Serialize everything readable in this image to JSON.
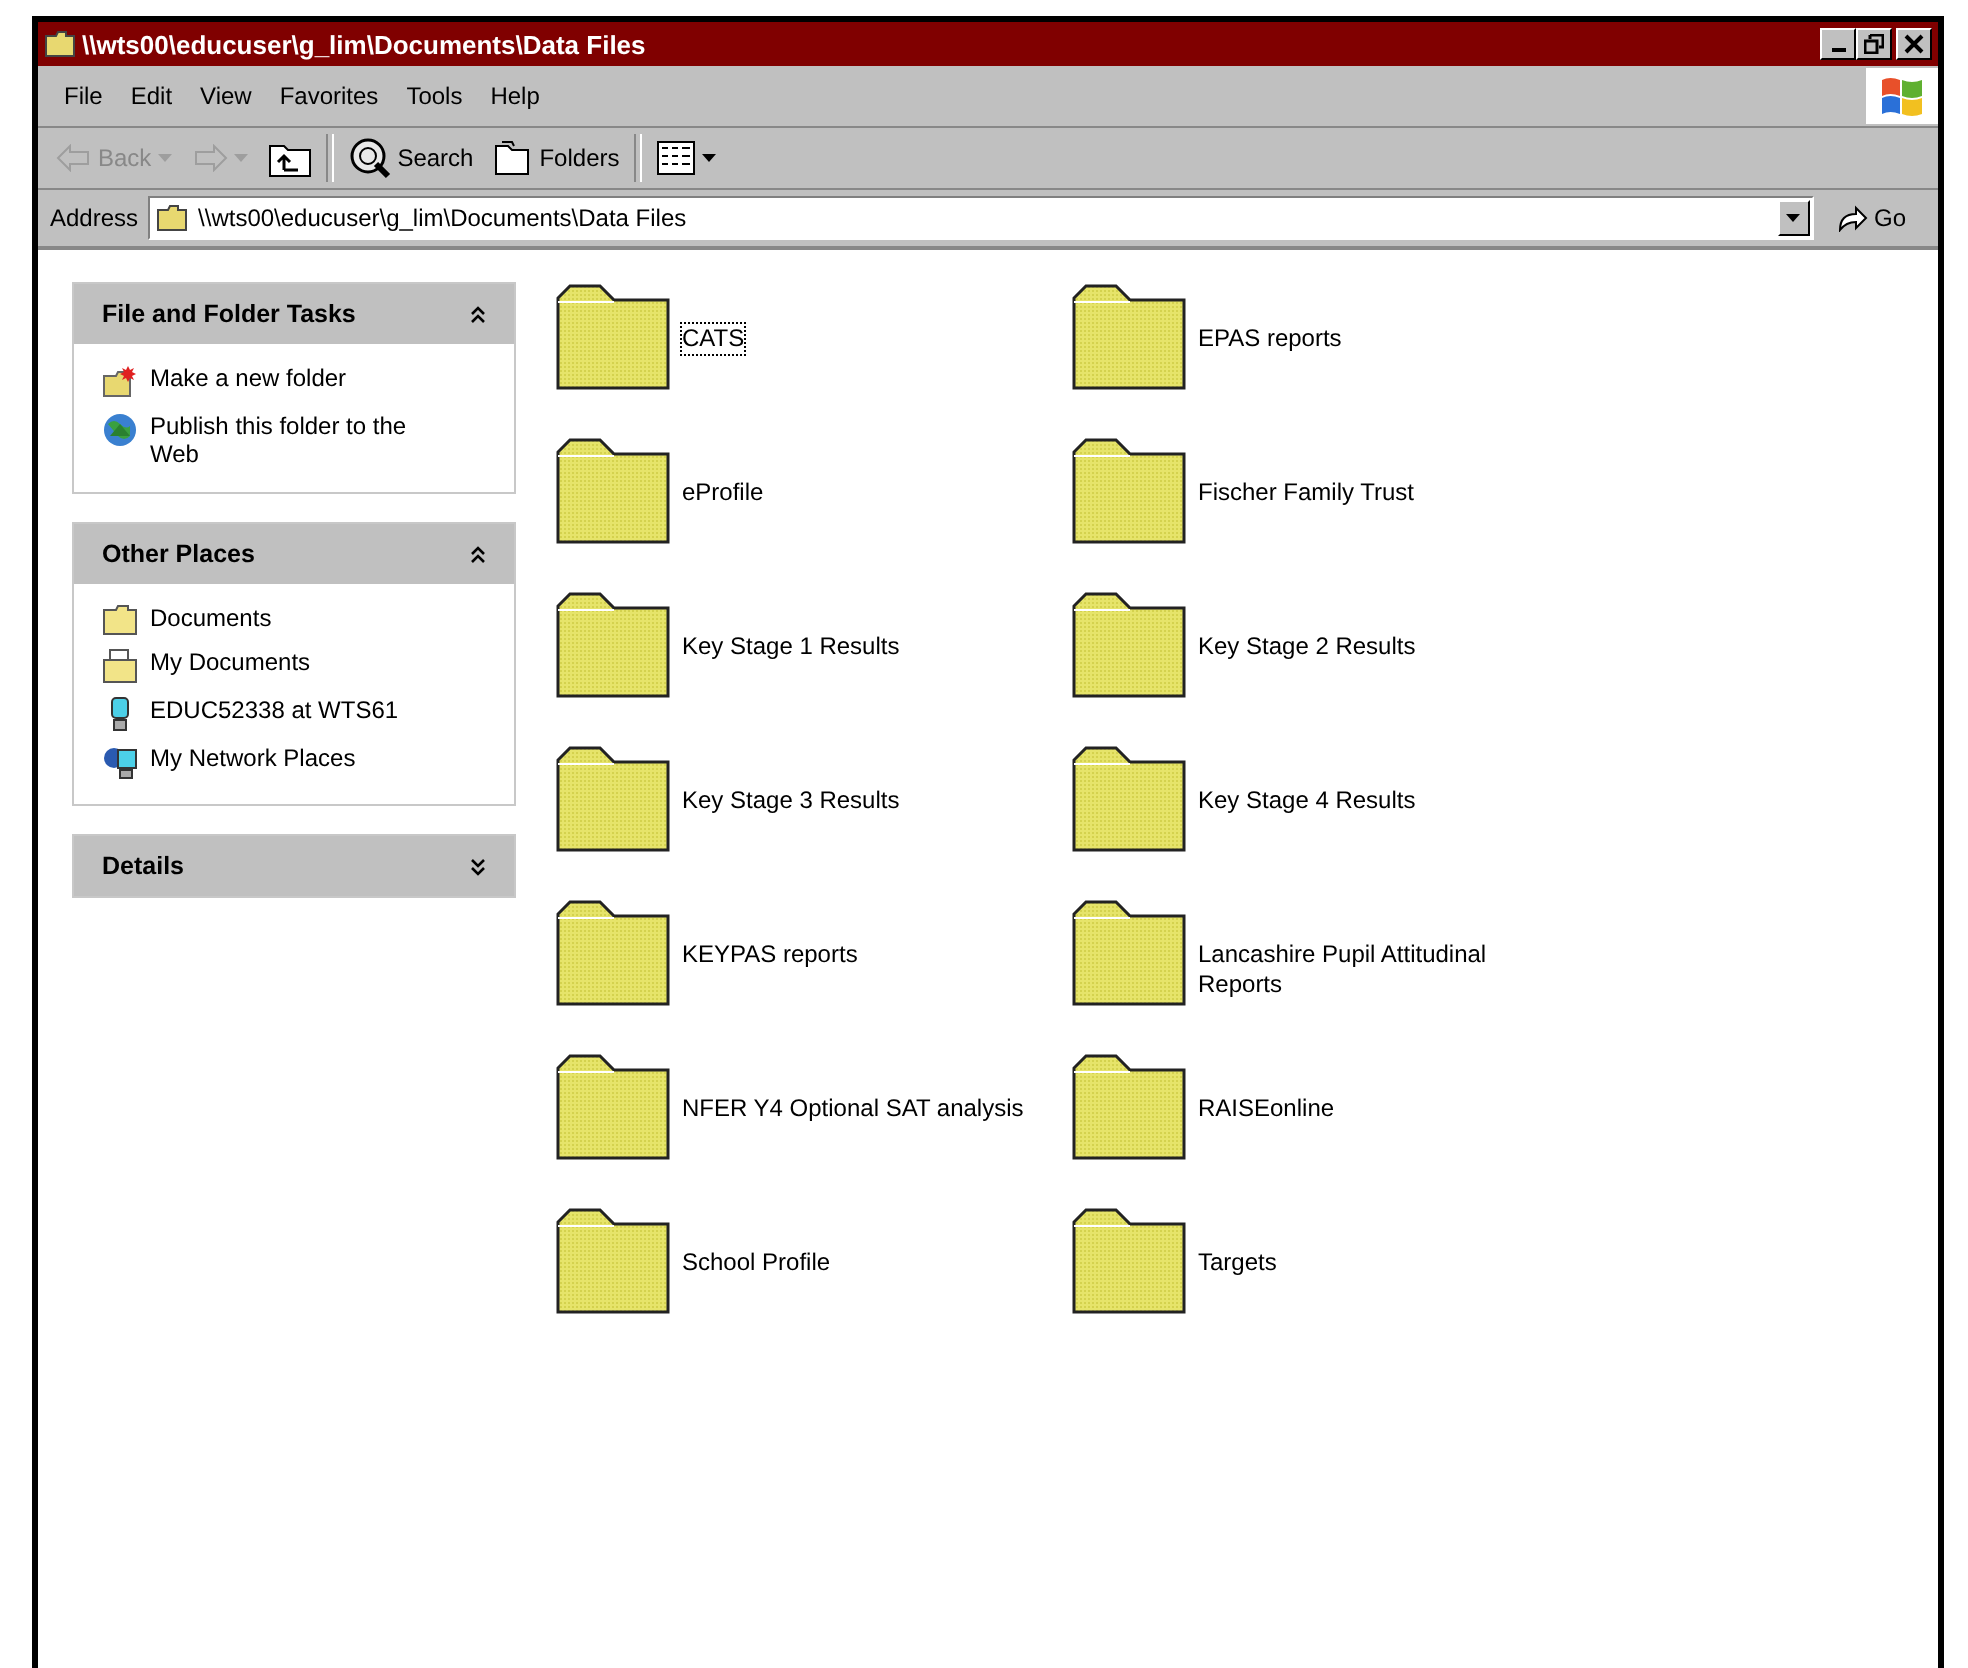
{
  "window": {
    "title": "\\\\wts00\\educuser\\g_lim\\Documents\\Data Files"
  },
  "menu": [
    "File",
    "Edit",
    "View",
    "Favorites",
    "Tools",
    "Help"
  ],
  "toolbar": [
    {
      "kind": "back",
      "label": "Back",
      "disabled": true
    },
    {
      "kind": "forward",
      "disabled": true
    },
    {
      "kind": "up",
      "disabled": false
    },
    {
      "kind": "search",
      "label": "Search",
      "disabled": false
    },
    {
      "kind": "folders",
      "label": "Folders",
      "disabled": false
    },
    {
      "kind": "views",
      "disabled": false
    }
  ],
  "address": {
    "label": "Address",
    "value": "\\\\wts00\\educuser\\g_lim\\Documents\\Data Files",
    "go": "Go"
  },
  "panels": [
    {
      "title": "File and Folder Tasks",
      "expanded": true,
      "items": [
        {
          "kind": "newfolder",
          "label": "Make a new folder"
        },
        {
          "kind": "publish",
          "label": "Publish this folder to the Web"
        }
      ]
    },
    {
      "title": "Other Places",
      "expanded": true,
      "items": [
        {
          "kind": "folder",
          "label": "Documents"
        },
        {
          "kind": "mydocs",
          "label": "My Documents"
        },
        {
          "kind": "computer",
          "label": "EDUC52338 at WTS61"
        },
        {
          "kind": "network",
          "label": "My Network Places"
        }
      ]
    },
    {
      "title": "Details",
      "expanded": false
    }
  ],
  "folders": [
    {
      "name": "CATS",
      "focused": true
    },
    {
      "name": "EPAS reports",
      "focused": false
    },
    {
      "name": "eProfile",
      "focused": false
    },
    {
      "name": "Fischer Family Trust",
      "focused": false
    },
    {
      "name": "Key Stage 1 Results",
      "focused": false
    },
    {
      "name": "Key Stage 2 Results",
      "focused": false
    },
    {
      "name": "Key Stage 3 Results",
      "focused": false
    },
    {
      "name": "Key Stage 4 Results",
      "focused": false
    },
    {
      "name": "KEYPAS reports",
      "focused": false
    },
    {
      "name": "Lancashire Pupil Attitudinal Reports",
      "focused": false
    },
    {
      "name": "NFER Y4 Optional SAT analysis",
      "focused": false
    },
    {
      "name": "RAISEonline",
      "focused": false
    },
    {
      "name": "School Profile",
      "focused": false
    },
    {
      "name": "Targets",
      "focused": false
    }
  ]
}
